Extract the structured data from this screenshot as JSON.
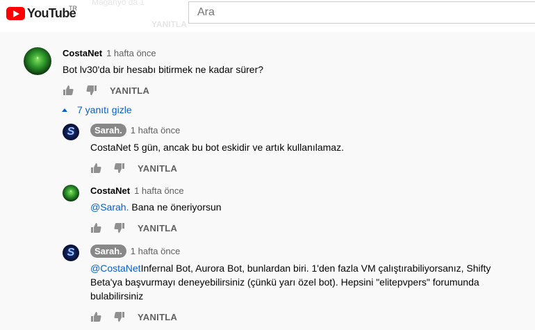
{
  "header": {
    "logo_text": "YouTube",
    "region": "TR",
    "search_placeholder": "Ara",
    "ghost_lines": [
      "Maganyo da 1",
      "YANITLA"
    ]
  },
  "colors": {
    "link_blue": "#065fd4",
    "badge_gray": "#888888",
    "logo_red": "#ff0000"
  },
  "thread": {
    "top_comment": {
      "author": "CostaNet",
      "time": "1 hafta önce",
      "text": "Bot lv30'da bir hesabı bitirmek ne kadar sürer?",
      "reply_label": "YANITLA",
      "avatar_icon": "costanet-avatar"
    },
    "replies_toggle": "7 yanıtı gizle",
    "replies": [
      {
        "author": "Sarah.",
        "time": "1 hafta önce",
        "text": "CostaNet 5 gün, ancak bu bot eskidir ve artık kullanılamaz.",
        "reply_label": "YANITLA"
      },
      {
        "author": "CostaNet",
        "time": "1 hafta önce",
        "mention": "@Sarah.",
        "text": " Bana ne öneriyorsun",
        "reply_label": "YANITLA"
      },
      {
        "author": "Sarah.",
        "time": "1 hafta önce",
        "mention": "@CostaNet",
        "text": "Infernal Bot, Aurora Bot, bunlardan biri. 1'den fazla VM çalıştırabiliyorsanız, Shifty Beta'ya başvurmayı deneyebilirsiniz (çünkü yarı özel bot). Hepsini \"elitepvpers\" forumunda bulabilirsiniz",
        "reply_label": "YANITLA"
      }
    ]
  }
}
